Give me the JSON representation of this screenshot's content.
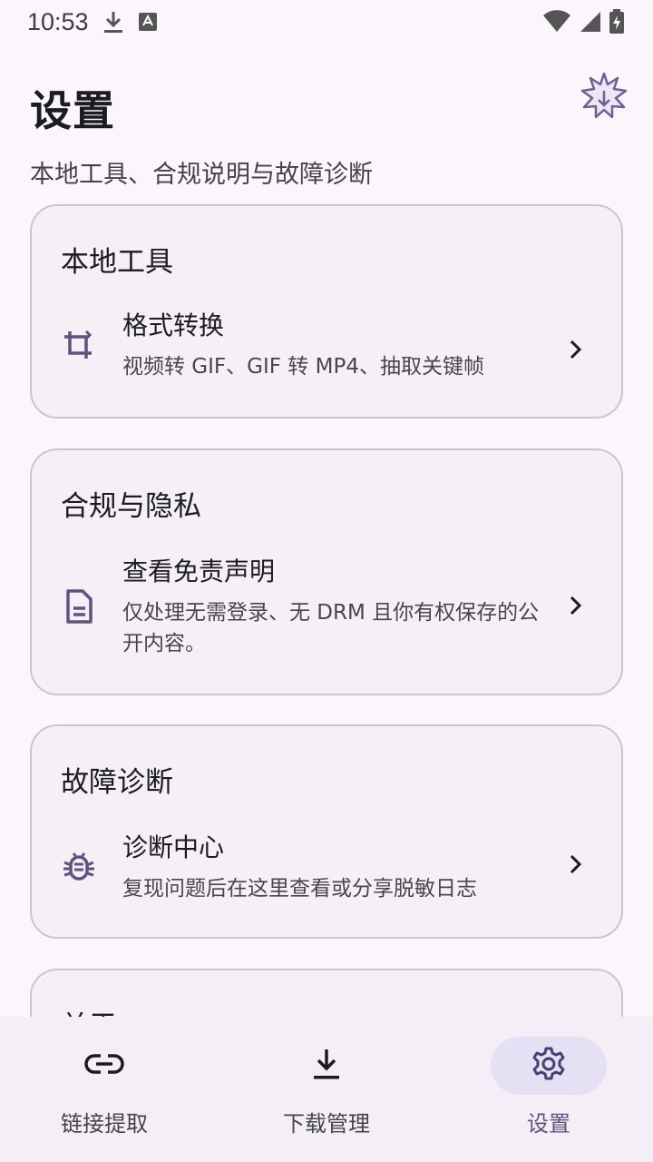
{
  "status_bar": {
    "time": "10:53",
    "icons": [
      "download-icon",
      "keyboard-a-icon",
      "wifi-icon",
      "signal-icon",
      "battery-charging-icon"
    ]
  },
  "header": {
    "title": "设置",
    "subtitle": "本地工具、合规说明与故障诊断",
    "badge_icon": "starburst-badge-icon"
  },
  "sections": [
    {
      "title": "本地工具",
      "item": {
        "icon": "crop-icon",
        "title": "格式转换",
        "description": "视频转 GIF、GIF 转 MP4、抽取关键帧"
      }
    },
    {
      "title": "合规与隐私",
      "item": {
        "icon": "document-icon",
        "title": "查看免责声明",
        "description": "仅处理无需登录、无 DRM 且你有权保存的公开内容。"
      }
    },
    {
      "title": "故障诊断",
      "item": {
        "icon": "bug-icon",
        "title": "诊断中心",
        "description": "复现问题后在这里查看或分享脱敏日志"
      }
    },
    {
      "title": "关于"
    }
  ],
  "bottom_nav": {
    "items": [
      {
        "label": "链接提取",
        "icon": "link-icon",
        "active": false
      },
      {
        "label": "下载管理",
        "icon": "download-icon",
        "active": false
      },
      {
        "label": "设置",
        "icon": "gear-icon",
        "active": true
      }
    ]
  },
  "colors": {
    "background": "#faf6fc",
    "card": "#f4f0f6",
    "accent": "#5d5480",
    "active_pill": "#e6e0f4"
  }
}
